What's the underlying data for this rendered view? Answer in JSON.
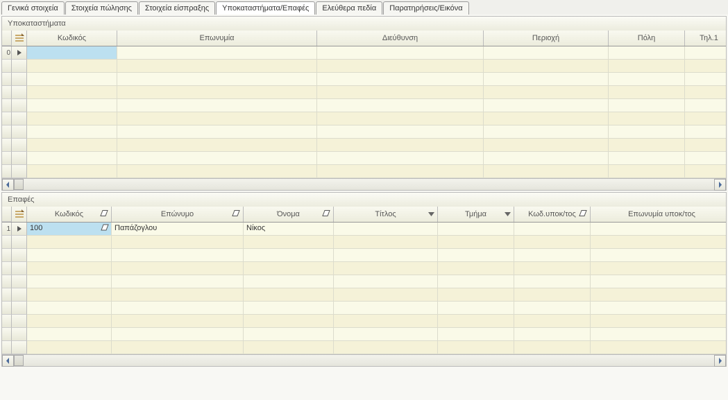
{
  "tabs": [
    {
      "label": "Γενικά στοιχεία",
      "active": false
    },
    {
      "label": "Στοιχεία πώλησης",
      "active": false
    },
    {
      "label": "Στοιχεία είσπραξης",
      "active": false
    },
    {
      "label": "Υποκαταστήματα/Επαφές",
      "active": true
    },
    {
      "label": "Ελεύθερα πεδία",
      "active": false
    },
    {
      "label": "Παρατηρήσεις/Εικόνα",
      "active": false
    }
  ],
  "branches": {
    "title": "Υποκαταστήματα",
    "rowcount": "0",
    "columns": [
      "Κωδικός",
      "Επωνυμία",
      "Διεύθυνση",
      "Περιοχή",
      "Πόλη",
      "Τηλ.1"
    ],
    "rows": [
      {
        "kodikos": "",
        "eponymia": "",
        "dieythynsi": "",
        "periochi": "",
        "poli": "",
        "til1": ""
      }
    ]
  },
  "contacts": {
    "title": "Επαφές",
    "rowcount": "1",
    "columns": [
      "Κωδικός",
      "Επώνυμο",
      "Όνομα",
      "Τίτλος",
      "Τμήμα",
      "Κωδ.υποκ/τος",
      "Επωνυμία υποκ/τος"
    ],
    "rows": [
      {
        "kodikos": "100",
        "eponymo": "Παπάζογλου",
        "onoma": "Νίκος",
        "titlos": "",
        "tmima": "",
        "kod_ypok": "",
        "epon_ypok": ""
      }
    ]
  },
  "icons": {
    "eraser": "eraser-icon",
    "dropdown": "dropdown-icon",
    "grid_corner": "grid-options-icon",
    "row_indicator": "current-row-indicator"
  }
}
